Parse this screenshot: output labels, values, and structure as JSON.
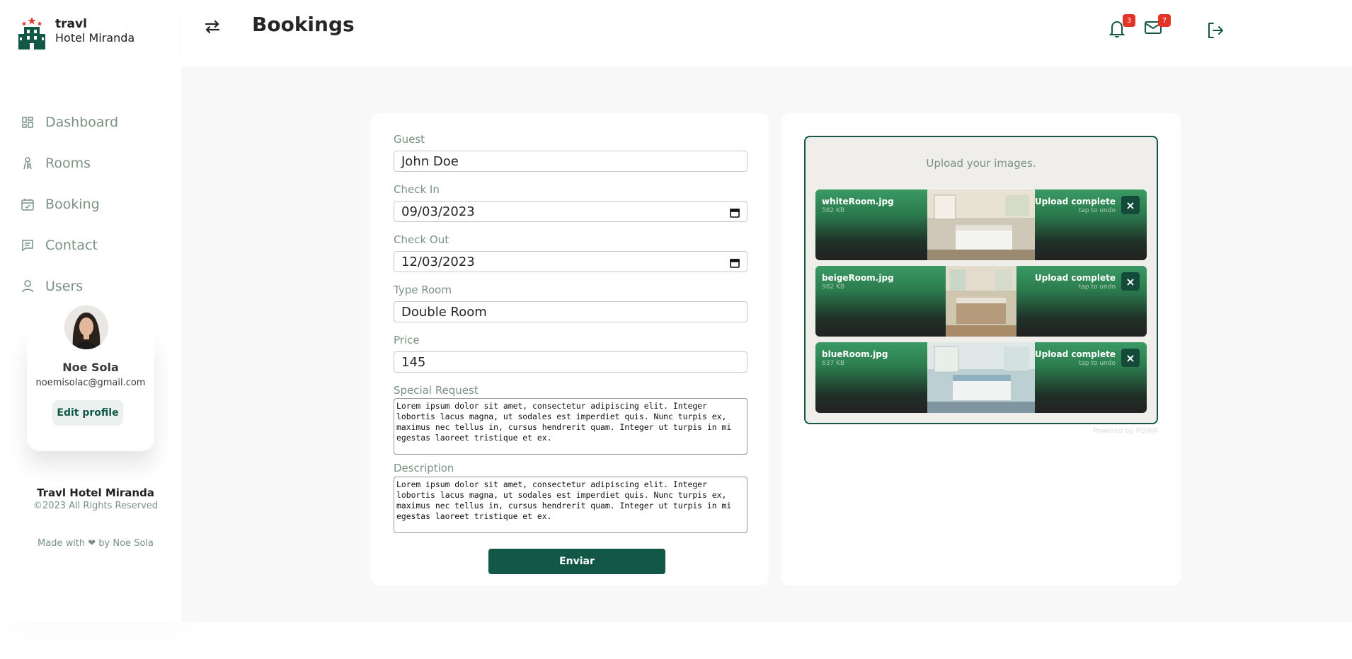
{
  "app": {
    "logo_title": "travl",
    "logo_subtitle": "Hotel Miranda"
  },
  "sidebar": {
    "items": [
      {
        "label": "Dashboard",
        "icon": "dashboard-icon"
      },
      {
        "label": "Rooms",
        "icon": "key-icon"
      },
      {
        "label": "Booking",
        "icon": "calendar-check-icon"
      },
      {
        "label": "Contact",
        "icon": "message-icon"
      },
      {
        "label": "Users",
        "icon": "user-icon"
      }
    ],
    "profile": {
      "name": "Noe Sola",
      "email": "noemisolac@gmail.com",
      "edit_label": "Edit profile"
    },
    "footer": {
      "title": "Travl Hotel Miranda",
      "copyright": "©2023 All Rights Reserved",
      "made_with": "Made with ❤ by Noe Sola"
    }
  },
  "header": {
    "title": "Bookings",
    "notifications_count": "3",
    "messages_count": "7"
  },
  "form": {
    "guest_label": "Guest",
    "guest_value": "John Doe",
    "checkin_label": "Check In",
    "checkin_value": "09/03/2023",
    "checkout_label": "Check Out",
    "checkout_value": "12/03/2023",
    "type_label": "Type Room",
    "type_value": "Double Room",
    "price_label": "Price",
    "price_value": "145",
    "special_label": "Special Request",
    "special_value": "Lorem ipsum dolor sit amet, consectetur adipiscing elit. Integer lobortis lacus magna, ut sodales est imperdiet quis. Nunc turpis ex, maximus nec tellus in, cursus hendrerit quam. Integer ut turpis in mi egestas laoreet tristique et ex.",
    "description_label": "Description",
    "description_value": "Lorem ipsum dolor sit amet, consectetur adipiscing elit. Integer lobortis lacus magna, ut sodales est imperdiet quis. Nunc turpis ex, maximus nec tellus in, cursus hendrerit quam. Integer ut turpis in mi egestas laoreet tristique et ex.",
    "submit_label": "Enviar"
  },
  "upload": {
    "prompt": "Upload your images.",
    "powered_by": "Powered by PQINA",
    "files": [
      {
        "name": "whiteRoom.jpg",
        "size": "582 KB",
        "status": "Upload complete",
        "undo": "tap to undo"
      },
      {
        "name": "beigeRoom.jpg",
        "size": "982 KB",
        "status": "Upload complete",
        "undo": "tap to undo"
      },
      {
        "name": "blueRoom.jpg",
        "size": "637 KB",
        "status": "Upload complete",
        "undo": "tap to undo"
      }
    ]
  },
  "colors": {
    "accent": "#135846",
    "muted": "#799283",
    "badge": "#E23428"
  }
}
